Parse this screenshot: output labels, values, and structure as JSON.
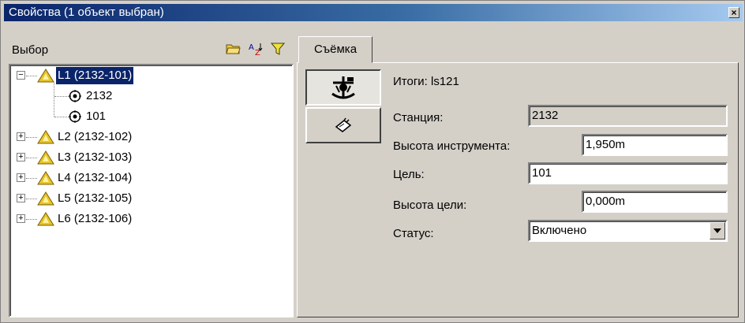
{
  "window": {
    "title": "Свойства (1 объект выбран)",
    "close_glyph": "×"
  },
  "left": {
    "header_label": "Выбор",
    "icons": [
      "folder-open-icon",
      "sort-az-icon",
      "filter-icon"
    ],
    "tree": [
      {
        "label": "L1 (2132-101)",
        "expanded": true,
        "selected": true,
        "children": [
          {
            "label": "2132"
          },
          {
            "label": "101"
          }
        ]
      },
      {
        "label": "L2 (2132-102)",
        "expanded": false
      },
      {
        "label": "L3 (2132-103)",
        "expanded": false
      },
      {
        "label": "L4 (2132-104)",
        "expanded": false
      },
      {
        "label": "L5 (2132-105)",
        "expanded": false
      },
      {
        "label": "L6 (2132-106)",
        "expanded": false
      }
    ]
  },
  "right": {
    "tab_label": "Съёмка",
    "summary": "Итоги: ls121",
    "fields": {
      "station_label": "Станция:",
      "station_value": "2132",
      "inst_height_label": "Высота инструмента:",
      "inst_height_value": "1,950m",
      "target_label": "Цель:",
      "target_value": "101",
      "target_height_label": "Высота цели:",
      "target_height_value": "0,000m",
      "status_label": "Статус:",
      "status_value": "Включено"
    }
  },
  "tree_expander": {
    "plus": "+",
    "minus": "−"
  }
}
